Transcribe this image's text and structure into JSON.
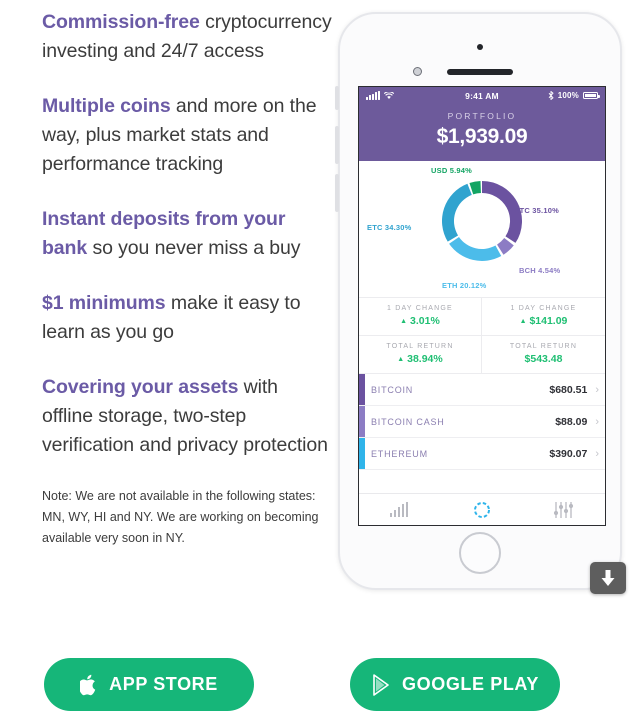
{
  "features": [
    {
      "highlight": "Commission-free",
      "rest": " cryptocurrency investing and 24/7 access"
    },
    {
      "highlight": "Multiple coins",
      "rest": " and more on the way, plus market stats and performance tracking"
    },
    {
      "highlight": "Instant deposits from your bank",
      "rest": " so you never miss a buy"
    },
    {
      "highlight": "$1 minimums",
      "rest": " make it easy to learn as you go"
    },
    {
      "highlight": "Covering your assets",
      "rest": " with offline storage, two-step verification and privacy protection"
    }
  ],
  "note": "Note: We are not available in the following states: MN, WY, HI and NY. We are working on becoming available very soon in NY.",
  "phone": {
    "status_bar": {
      "time": "9:41 AM",
      "battery_pct": "100%"
    },
    "header": {
      "label": "PORTFOLIO",
      "amount": "$1,939.09"
    },
    "stats": [
      {
        "label": "1 DAY CHANGE",
        "value": "3.01%",
        "arrow": "▲",
        "color": "#1fbf73"
      },
      {
        "label": "1 DAY CHANGE",
        "value": "$141.09",
        "arrow": "▲",
        "color": "#1fbf73"
      },
      {
        "label": "TOTAL RETURN",
        "value": "38.94%",
        "arrow": "▲",
        "color": "#1fbf73"
      },
      {
        "label": "TOTAL RETURN",
        "value": "$543.48",
        "arrow": "",
        "color": "#1fbf73"
      }
    ],
    "coins": [
      {
        "name": "BITCOIN",
        "value": "$680.51",
        "color": "#6b52a0"
      },
      {
        "name": "BITCOIN CASH",
        "value": "$88.09",
        "color": "#8c7cc4"
      },
      {
        "name": "ETHEREUM",
        "value": "$390.07",
        "color": "#2fb4ea"
      }
    ],
    "tabs": [
      {
        "icon": "bar-chart-icon",
        "active": false
      },
      {
        "icon": "donut-icon",
        "active": true
      },
      {
        "icon": "sliders-icon",
        "active": false
      }
    ]
  },
  "chart_data": {
    "type": "pie",
    "title": "PORTFOLIO",
    "labels": [
      "BTC",
      "BCH",
      "ETH",
      "ETC",
      "USD"
    ],
    "values": [
      35.1,
      4.54,
      20.12,
      34.3,
      5.94
    ],
    "value_labels": [
      "BTC 35.10%",
      "BCH 4.54%",
      "ETH 20.12%",
      "ETC 34.30%",
      "USD 5.94%"
    ],
    "colors": [
      "#6b52a0",
      "#8c7cc4",
      "#4cbcea",
      "#30a3cf",
      "#13a463"
    ],
    "donut": true,
    "legend": "labels-outside",
    "total": "$1,939.09"
  },
  "download_badge": {
    "icon": "download-arrow-icon"
  },
  "stores": [
    {
      "label": "APP STORE",
      "icon": "apple-icon",
      "color": "#16b679"
    },
    {
      "label": "GOOGLE PLAY",
      "icon": "play-triangle-icon",
      "color": "#16b679"
    }
  ]
}
